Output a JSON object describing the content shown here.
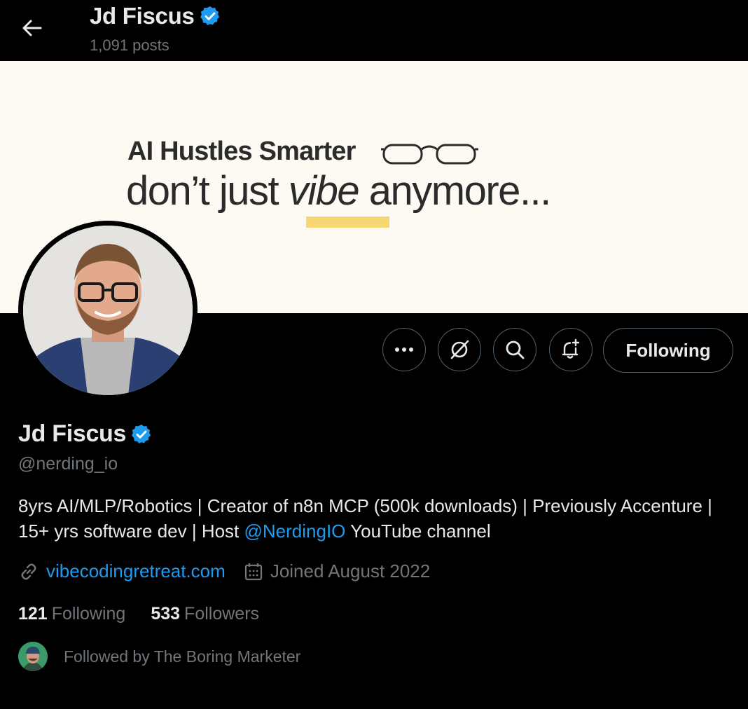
{
  "header": {
    "name": "Jd Fiscus",
    "posts": "1,091 posts"
  },
  "banner": {
    "line1": "AI Hustles Smarter",
    "line2_pre": "don’t just ",
    "line2_em": "vibe",
    "line2_post": " anymore...",
    "accent_color": "#f7d774"
  },
  "actions": {
    "more_icon": "more-icon",
    "grok_icon": "grok-icon",
    "search_icon": "search-icon",
    "notify_icon": "bell-plus-icon",
    "following_label": "Following"
  },
  "profile": {
    "name": "Jd Fiscus",
    "handle": "@nerding_io",
    "bio_part1": "8yrs AI/MLP/Robotics | Creator of n8n MCP (500k downloads) | Previously Accenture | 15+ yrs software dev | Host ",
    "bio_mention": "@NerdingIO",
    "bio_part2": " YouTube channel",
    "website": "vibecodingretreat.com",
    "joined": "Joined August 2022",
    "following_count": "121",
    "following_label": "Following",
    "followers_count": "533",
    "followers_label": "Followers",
    "followed_by": "Followed by The Boring Marketer"
  },
  "colors": {
    "link": "#1d9bf0",
    "muted": "#71767b",
    "text": "#e7e9ea",
    "border": "#536471"
  }
}
